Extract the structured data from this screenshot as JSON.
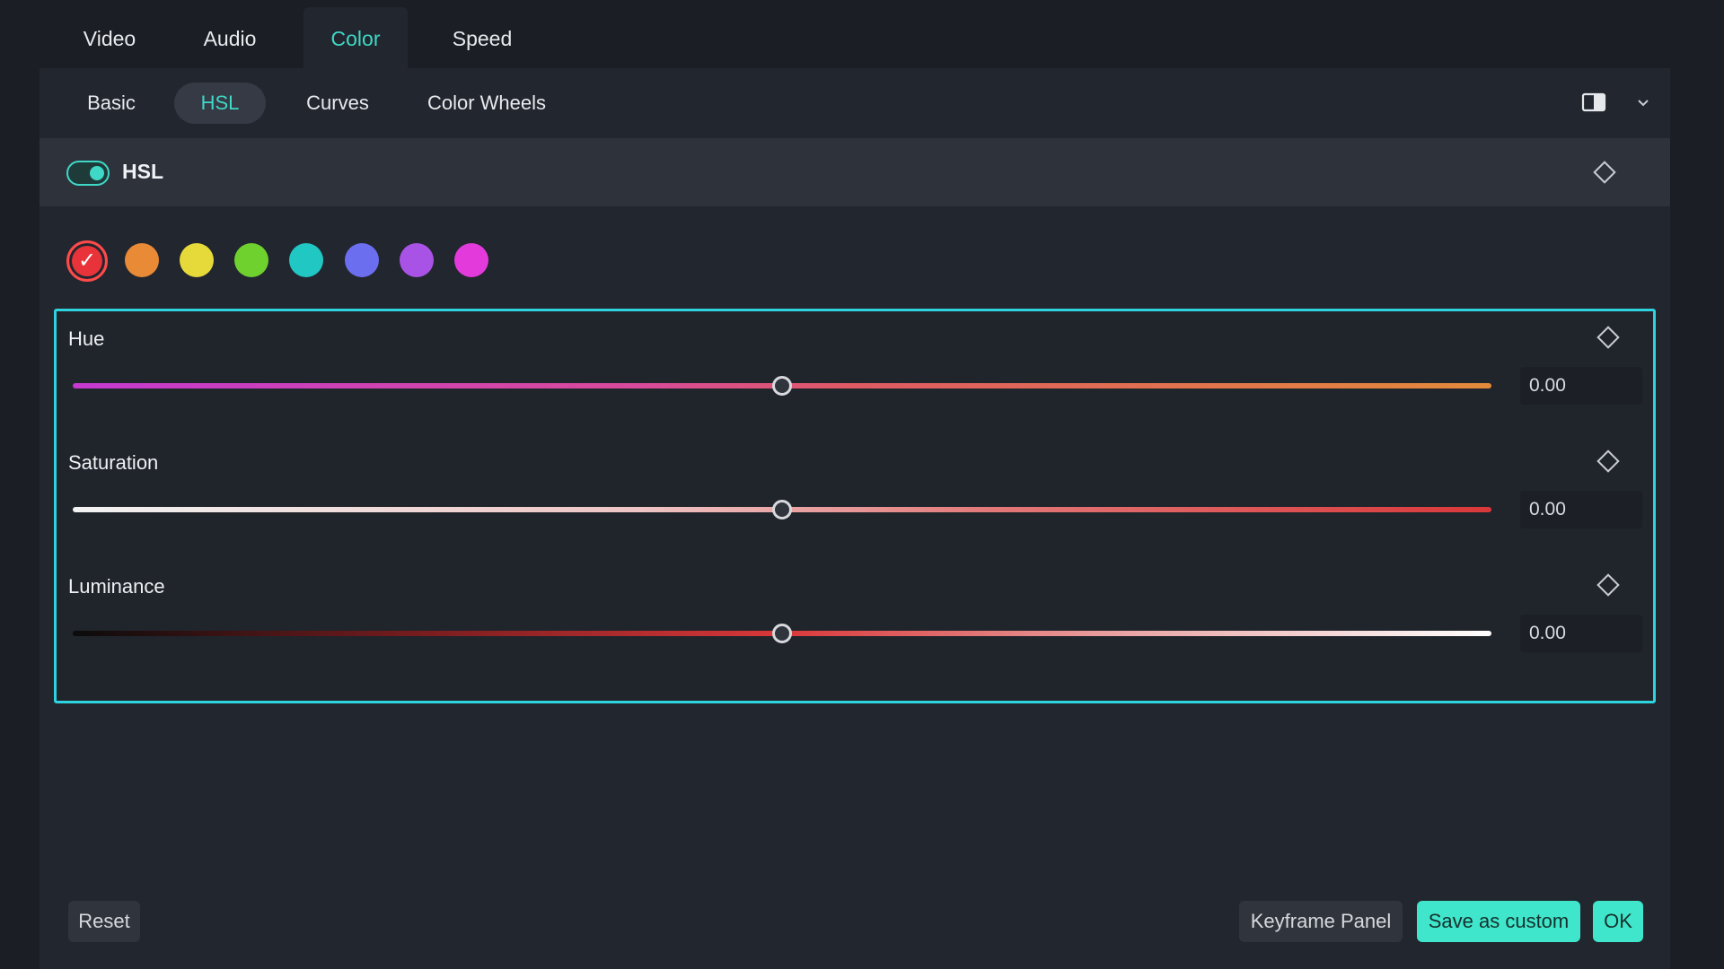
{
  "top_tabs": [
    {
      "label": "Video"
    },
    {
      "label": "Audio"
    },
    {
      "label": "Color",
      "active": true
    },
    {
      "label": "Speed"
    }
  ],
  "sub_tabs": [
    {
      "label": "Basic"
    },
    {
      "label": "HSL",
      "active": true
    },
    {
      "label": "Curves"
    },
    {
      "label": "Color Wheels"
    }
  ],
  "hsl_section": {
    "label": "HSL",
    "enabled": true
  },
  "color_swatches": [
    {
      "name": "red",
      "color": "#e8333a",
      "selected": true,
      "check": "✓"
    },
    {
      "name": "orange",
      "color": "#e88a36"
    },
    {
      "name": "yellow",
      "color": "#e6d93a"
    },
    {
      "name": "green",
      "color": "#6fd12e"
    },
    {
      "name": "cyan",
      "color": "#21c7c2"
    },
    {
      "name": "blue",
      "color": "#6c6ef0"
    },
    {
      "name": "purple",
      "color": "#a953e6"
    },
    {
      "name": "magenta",
      "color": "#e33adb"
    }
  ],
  "sliders": [
    {
      "label": "Hue",
      "value": "0.00",
      "position": 0.5
    },
    {
      "label": "Saturation",
      "value": "0.00",
      "position": 0.5
    },
    {
      "label": "Luminance",
      "value": "0.00",
      "position": 0.5
    }
  ],
  "buttons": {
    "reset": "Reset",
    "keyframe_panel": "Keyframe Panel",
    "save_as_custom": "Save as custom",
    "ok": "OK"
  },
  "colors": {
    "accent": "#3fd8c6",
    "highlight_border": "#2fd3df"
  }
}
